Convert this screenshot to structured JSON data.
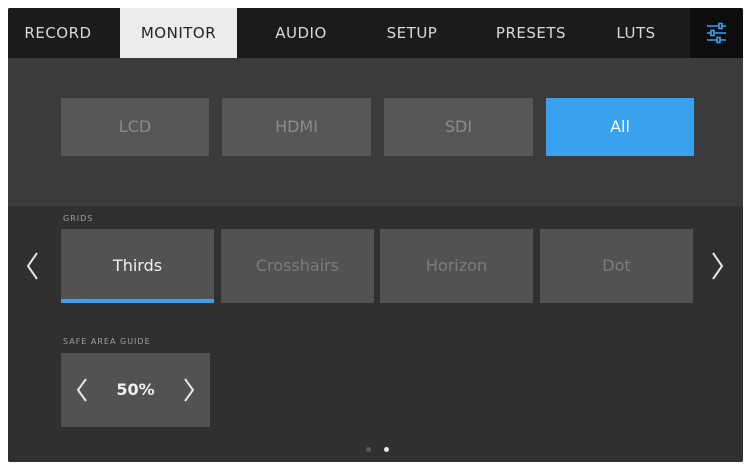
{
  "tabs": [
    {
      "label": "RECORD",
      "active": false
    },
    {
      "label": "MONITOR",
      "active": true
    },
    {
      "label": "AUDIO",
      "active": false
    },
    {
      "label": "SETUP",
      "active": false
    },
    {
      "label": "PRESETS",
      "active": false
    },
    {
      "label": "LUTS",
      "active": false
    }
  ],
  "settings_icon": "sliders-icon",
  "outputs": [
    {
      "label": "LCD",
      "active": false
    },
    {
      "label": "HDMI",
      "active": false
    },
    {
      "label": "SDI",
      "active": false
    },
    {
      "label": "All",
      "active": true
    }
  ],
  "grids": {
    "label": "GRIDS",
    "options": [
      {
        "label": "Thirds",
        "active": true
      },
      {
        "label": "Crosshairs",
        "active": false
      },
      {
        "label": "Horizon",
        "active": false
      },
      {
        "label": "Dot",
        "active": false
      }
    ]
  },
  "safe_area": {
    "label": "SAFE AREA GUIDE",
    "value": "50%"
  },
  "pagination": {
    "pages": 2,
    "current": 2
  },
  "colors": {
    "accent": "#3aa1ee",
    "tabbar": "#1b1b1b",
    "active_tab": "#ececec"
  }
}
